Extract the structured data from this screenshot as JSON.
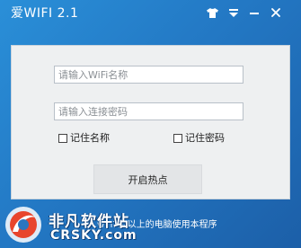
{
  "window": {
    "title": "爱WIFI 2.1"
  },
  "titlebar": {
    "skin_icon": "tshirt-icon",
    "menu_icon": "menu-down-icon",
    "minimize_icon": "minimize-icon",
    "close_icon": "close-icon"
  },
  "form": {
    "wifi_name_placeholder": "请输入WiFi名称",
    "password_placeholder": "请输入连接密码",
    "remember_name_label": "记住名称",
    "remember_password_label": "记住密码",
    "remember_name_checked": false,
    "remember_password_checked": false,
    "start_button_label": "开启热点"
  },
  "footer": {
    "note": "win7及以上的电脑使用本程序"
  },
  "watermark": {
    "cn": "非凡软件站",
    "en": "CRSKY.com",
    "logo_icon": "crsky-logo-icon"
  },
  "colors": {
    "window_bg": "#2378c4",
    "panel_bg": "#eef0f1",
    "button_bg": "#e3e5e7",
    "text_light": "#ffffff"
  }
}
